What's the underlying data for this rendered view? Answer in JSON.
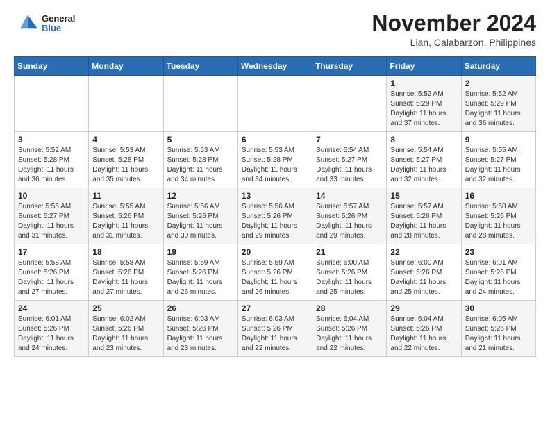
{
  "header": {
    "logo_general": "General",
    "logo_blue": "Blue",
    "month_title": "November 2024",
    "location": "Lian, Calabarzon, Philippines"
  },
  "days_of_week": [
    "Sunday",
    "Monday",
    "Tuesday",
    "Wednesday",
    "Thursday",
    "Friday",
    "Saturday"
  ],
  "weeks": [
    [
      {
        "day": "",
        "info": ""
      },
      {
        "day": "",
        "info": ""
      },
      {
        "day": "",
        "info": ""
      },
      {
        "day": "",
        "info": ""
      },
      {
        "day": "",
        "info": ""
      },
      {
        "day": "1",
        "info": "Sunrise: 5:52 AM\nSunset: 5:29 PM\nDaylight: 11 hours\nand 37 minutes."
      },
      {
        "day": "2",
        "info": "Sunrise: 5:52 AM\nSunset: 5:29 PM\nDaylight: 11 hours\nand 36 minutes."
      }
    ],
    [
      {
        "day": "3",
        "info": "Sunrise: 5:52 AM\nSunset: 5:28 PM\nDaylight: 11 hours\nand 36 minutes."
      },
      {
        "day": "4",
        "info": "Sunrise: 5:53 AM\nSunset: 5:28 PM\nDaylight: 11 hours\nand 35 minutes."
      },
      {
        "day": "5",
        "info": "Sunrise: 5:53 AM\nSunset: 5:28 PM\nDaylight: 11 hours\nand 34 minutes."
      },
      {
        "day": "6",
        "info": "Sunrise: 5:53 AM\nSunset: 5:28 PM\nDaylight: 11 hours\nand 34 minutes."
      },
      {
        "day": "7",
        "info": "Sunrise: 5:54 AM\nSunset: 5:27 PM\nDaylight: 11 hours\nand 33 minutes."
      },
      {
        "day": "8",
        "info": "Sunrise: 5:54 AM\nSunset: 5:27 PM\nDaylight: 11 hours\nand 32 minutes."
      },
      {
        "day": "9",
        "info": "Sunrise: 5:55 AM\nSunset: 5:27 PM\nDaylight: 11 hours\nand 32 minutes."
      }
    ],
    [
      {
        "day": "10",
        "info": "Sunrise: 5:55 AM\nSunset: 5:27 PM\nDaylight: 11 hours\nand 31 minutes."
      },
      {
        "day": "11",
        "info": "Sunrise: 5:55 AM\nSunset: 5:26 PM\nDaylight: 11 hours\nand 31 minutes."
      },
      {
        "day": "12",
        "info": "Sunrise: 5:56 AM\nSunset: 5:26 PM\nDaylight: 11 hours\nand 30 minutes."
      },
      {
        "day": "13",
        "info": "Sunrise: 5:56 AM\nSunset: 5:26 PM\nDaylight: 11 hours\nand 29 minutes."
      },
      {
        "day": "14",
        "info": "Sunrise: 5:57 AM\nSunset: 5:26 PM\nDaylight: 11 hours\nand 29 minutes."
      },
      {
        "day": "15",
        "info": "Sunrise: 5:57 AM\nSunset: 5:26 PM\nDaylight: 11 hours\nand 28 minutes."
      },
      {
        "day": "16",
        "info": "Sunrise: 5:58 AM\nSunset: 5:26 PM\nDaylight: 11 hours\nand 28 minutes."
      }
    ],
    [
      {
        "day": "17",
        "info": "Sunrise: 5:58 AM\nSunset: 5:26 PM\nDaylight: 11 hours\nand 27 minutes."
      },
      {
        "day": "18",
        "info": "Sunrise: 5:58 AM\nSunset: 5:26 PM\nDaylight: 11 hours\nand 27 minutes."
      },
      {
        "day": "19",
        "info": "Sunrise: 5:59 AM\nSunset: 5:26 PM\nDaylight: 11 hours\nand 26 minutes."
      },
      {
        "day": "20",
        "info": "Sunrise: 5:59 AM\nSunset: 5:26 PM\nDaylight: 11 hours\nand 26 minutes."
      },
      {
        "day": "21",
        "info": "Sunrise: 6:00 AM\nSunset: 5:26 PM\nDaylight: 11 hours\nand 25 minutes."
      },
      {
        "day": "22",
        "info": "Sunrise: 6:00 AM\nSunset: 5:26 PM\nDaylight: 11 hours\nand 25 minutes."
      },
      {
        "day": "23",
        "info": "Sunrise: 6:01 AM\nSunset: 5:26 PM\nDaylight: 11 hours\nand 24 minutes."
      }
    ],
    [
      {
        "day": "24",
        "info": "Sunrise: 6:01 AM\nSunset: 5:26 PM\nDaylight: 11 hours\nand 24 minutes."
      },
      {
        "day": "25",
        "info": "Sunrise: 6:02 AM\nSunset: 5:26 PM\nDaylight: 11 hours\nand 23 minutes."
      },
      {
        "day": "26",
        "info": "Sunrise: 6:03 AM\nSunset: 5:26 PM\nDaylight: 11 hours\nand 23 minutes."
      },
      {
        "day": "27",
        "info": "Sunrise: 6:03 AM\nSunset: 5:26 PM\nDaylight: 11 hours\nand 22 minutes."
      },
      {
        "day": "28",
        "info": "Sunrise: 6:04 AM\nSunset: 5:26 PM\nDaylight: 11 hours\nand 22 minutes."
      },
      {
        "day": "29",
        "info": "Sunrise: 6:04 AM\nSunset: 5:26 PM\nDaylight: 11 hours\nand 22 minutes."
      },
      {
        "day": "30",
        "info": "Sunrise: 6:05 AM\nSunset: 5:26 PM\nDaylight: 11 hours\nand 21 minutes."
      }
    ]
  ]
}
